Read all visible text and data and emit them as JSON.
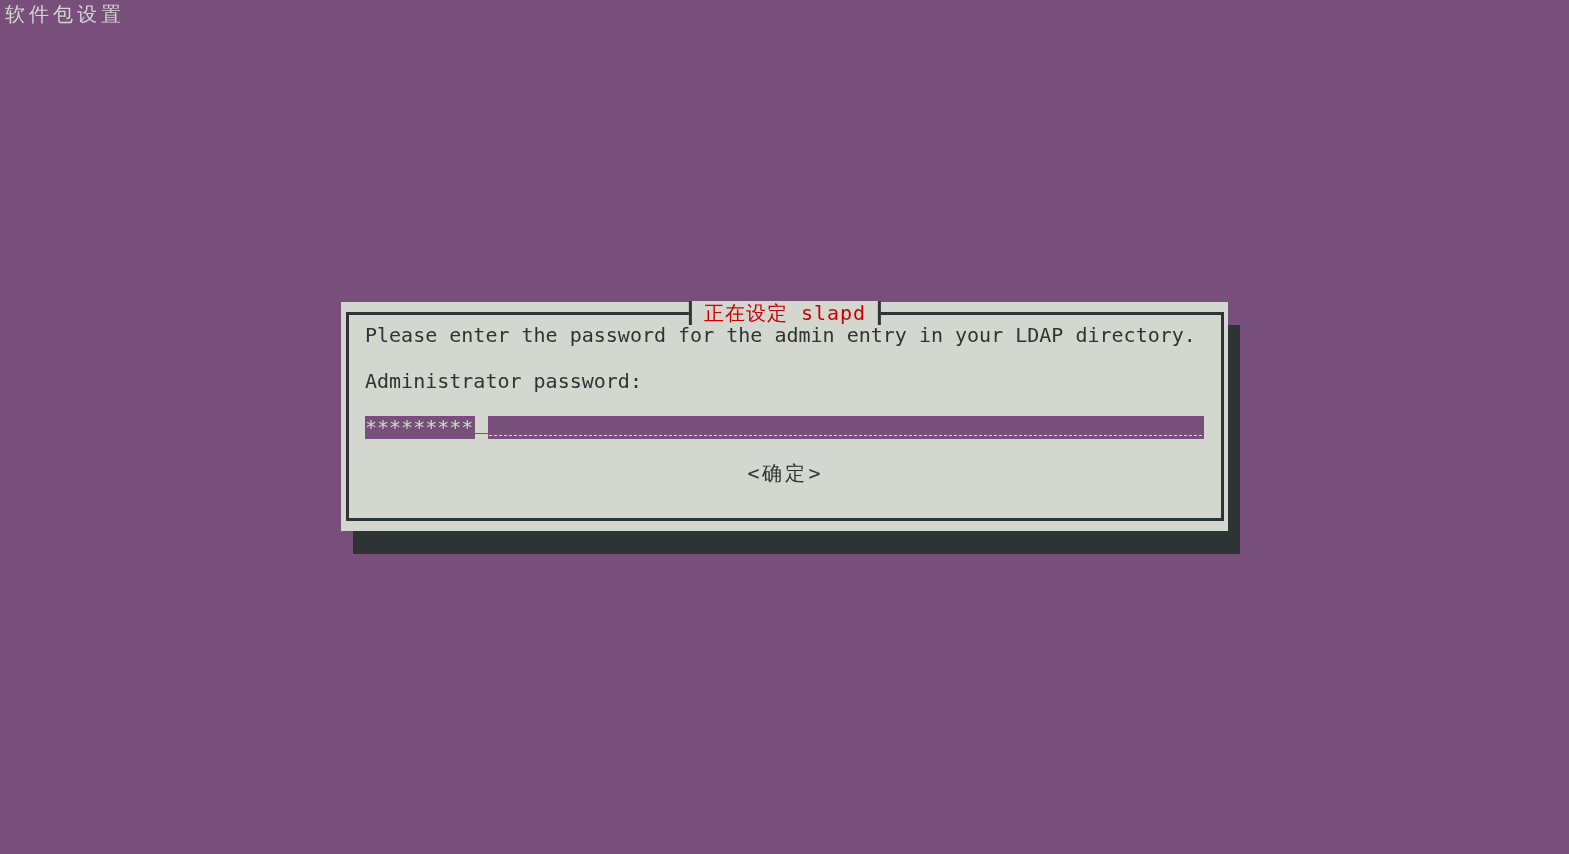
{
  "screen_title": "软件包设置",
  "dialog": {
    "title": "正在设定 slapd",
    "message": "Please enter the password for the admin entry in your LDAP directory.",
    "prompt": "Administrator password:",
    "password_field": {
      "value": "*********"
    },
    "buttons": [
      {
        "label": "<确定>"
      }
    ]
  }
}
